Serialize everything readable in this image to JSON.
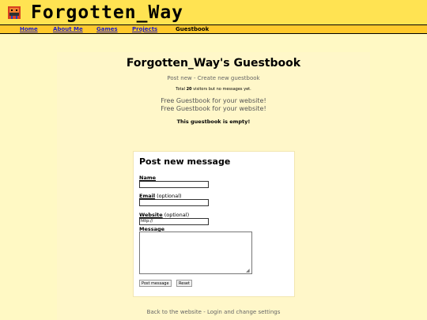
{
  "site": {
    "title": "Forgotten_Way"
  },
  "nav": {
    "items": [
      {
        "label": "Home"
      },
      {
        "label": "About Me"
      },
      {
        "label": "Games"
      },
      {
        "label": "Projects"
      },
      {
        "label": "Guestbook"
      }
    ],
    "current_label": "Guestbook"
  },
  "guestbook": {
    "title": "Forgotten_Way's Guestbook",
    "link_post_new": "Post new",
    "link_separator": "-",
    "link_create_new": "Create new guestbook",
    "stats_prefix": "Total ",
    "visitors": "20",
    "stats_suffix": " visitors but no messages yet.",
    "promo_line_1": "Free Guestbook for your website!",
    "promo_line_2": "Free Guestbook for your website!",
    "empty_message": "This guestbook is empty!"
  },
  "form": {
    "title": "Post new message",
    "name_label": "Name",
    "email_label": "Email",
    "email_note": " (optional)",
    "website_label": "Website",
    "website_note": " (optional)",
    "website_value": "http://",
    "message_label": "Message",
    "post_button": "Post message",
    "reset_button": "Reset"
  },
  "footer": {
    "back_link": "Back to the website",
    "separator": "-",
    "login_link": "Login and change settings"
  },
  "colors": {
    "header_bg": "#ffe352",
    "nav_bg": "#ffc92c",
    "page_bg": "#fff9c4",
    "nav_link": "#2020c8"
  },
  "icons": {
    "logo": "pixel-mascot-icon"
  }
}
